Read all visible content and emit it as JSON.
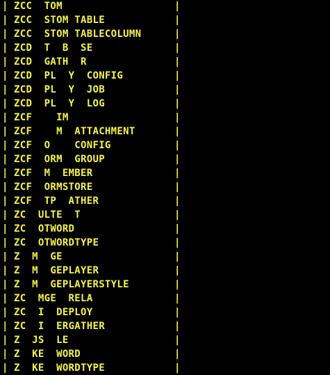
{
  "theme": {
    "background": "#000000",
    "text_color": "#f5f54a"
  },
  "separator": "|",
  "rows": [
    "ZCC  TOM",
    "ZCC  STOM TABLE",
    "ZCC  STOM TABLECOLUMN",
    "ZCD  T  B  SE",
    "ZCD  GATH  R",
    "ZCD  PL  Y  CONFIG",
    "ZCD  PL  Y  JOB",
    "ZCD  PL  Y  LOG",
    "ZCF    IM",
    "ZCF    M  ATTACHMENT",
    "ZCF  O    CONFIG",
    "ZCF  ORM  GROUP",
    "ZCF  M  EMBER",
    "ZCF  ORMSTORE",
    "ZCF  TP  ATHER",
    "ZC  ULTE  T",
    "ZC  OTWORD",
    "ZC  OTWORDTYPE",
    "Z  M  GE",
    "Z  M  GEPLAYER",
    "Z  M  GEPLAYERSTYLE",
    "ZC  MGE  RELA",
    "ZC  I  DEPLOY",
    "ZC  I  ERGATHER",
    "Z  JS  LE",
    "Z  KE  WORD",
    "Z  KE  WORDTYPE"
  ]
}
